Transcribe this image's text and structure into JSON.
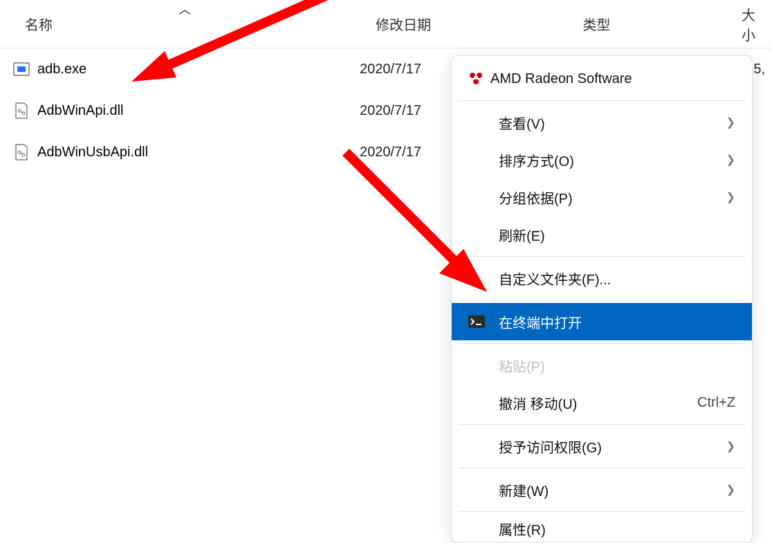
{
  "header": {
    "name": "名称",
    "date": "修改日期",
    "type": "类型",
    "size": "大小"
  },
  "files": [
    {
      "name": "adb.exe",
      "date": "2020/7/17",
      "size": "5,"
    },
    {
      "name": "AdbWinApi.dll",
      "date": "2020/7/17",
      "size": ""
    },
    {
      "name": "AdbWinUsbApi.dll",
      "date": "2020/7/17",
      "size": ""
    }
  ],
  "menu": {
    "amd": "AMD Radeon Software",
    "view": "查看(V)",
    "sort": "排序方式(O)",
    "group": "分组依据(P)",
    "refresh": "刷新(E)",
    "customize": "自定义文件夹(F)...",
    "open_terminal": "在终端中打开",
    "paste": "粘贴(P)",
    "undo": "撤消 移动(U)",
    "undo_shortcut": "Ctrl+Z",
    "access": "授予访问权限(G)",
    "new": "新建(W)",
    "properties": "属性(R)"
  }
}
